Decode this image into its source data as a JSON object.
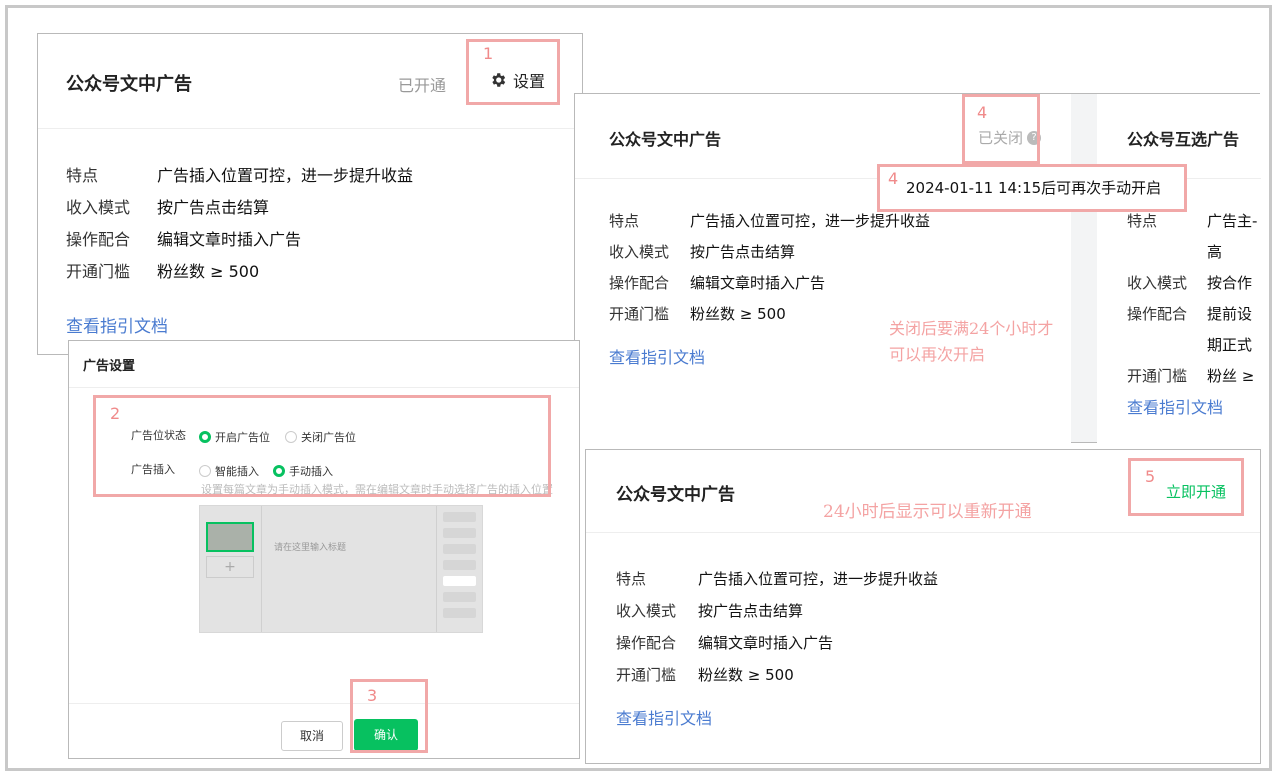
{
  "card_open": {
    "title": "公众号文中广告",
    "status": "已开通",
    "settings_label": "设置",
    "rows": [
      {
        "key": "特点",
        "value": "广告插入位置可控，进一步提升收益"
      },
      {
        "key": "收入模式",
        "value": "按广告点击结算"
      },
      {
        "key": "操作配合",
        "value": "编辑文章时插入广告"
      },
      {
        "key": "开通门槛",
        "value": "粉丝数 ≥ 500"
      }
    ],
    "guide_link": "查看指引文档"
  },
  "card_closed": {
    "title": "公众号文中广告",
    "status": "已关闭",
    "rows": [
      {
        "key": "特点",
        "value": "广告插入位置可控，进一步提升收益"
      },
      {
        "key": "收入模式",
        "value": "按广告点击结算"
      },
      {
        "key": "操作配合",
        "value": "编辑文章时插入广告"
      },
      {
        "key": "开通门槛",
        "value": "粉丝数 ≥ 500"
      }
    ],
    "guide_link": "查看指引文档",
    "tooltip": "2024-01-11 14:15后可再次手动开启",
    "note_line1": "关闭后要满24个小时才",
    "note_line2": "可以再次开启"
  },
  "card_mutual": {
    "title": "公众号互选广告",
    "rows": [
      {
        "key": "特点",
        "value": "广告主-"
      },
      {
        "key": "",
        "value": "高"
      },
      {
        "key": "收入模式",
        "value": "按合作"
      },
      {
        "key": "操作配合",
        "value": "提前设"
      },
      {
        "key": "",
        "value": "期正式"
      },
      {
        "key": "开通门槛",
        "value": "粉丝 ≥"
      }
    ],
    "guide_link": "查看指引文档"
  },
  "card_reopen": {
    "title": "公众号文中广告",
    "note": "24小时后显示可以重新开通",
    "open_now": "立即开通",
    "rows": [
      {
        "key": "特点",
        "value": "广告插入位置可控，进一步提升收益"
      },
      {
        "key": "收入模式",
        "value": "按广告点击结算"
      },
      {
        "key": "操作配合",
        "value": "编辑文章时插入广告"
      },
      {
        "key": "开通门槛",
        "value": "粉丝数 ≥ 500"
      }
    ],
    "guide_link": "查看指引文档"
  },
  "ad_settings": {
    "title": "广告设置",
    "status_label": "广告位状态",
    "status_on": "开启广告位",
    "status_off": "关闭广告位",
    "insert_label": "广告插入",
    "insert_smart": "智能插入",
    "insert_manual": "手动插入",
    "hint": "设置每篇文章为手动插入模式，需在编辑文章时手动选择广告的插入位置",
    "preview_placeholder": "请在这里输入标题",
    "cancel": "取消",
    "confirm": "确认"
  },
  "steps": {
    "s1": "1",
    "s2": "2",
    "s3": "3",
    "s4": "4",
    "s5": "5"
  },
  "colors": {
    "accent": "#07c160",
    "link": "#4a7bd0",
    "highlight": "#f1a8a8",
    "note": "#f4a3a3"
  }
}
